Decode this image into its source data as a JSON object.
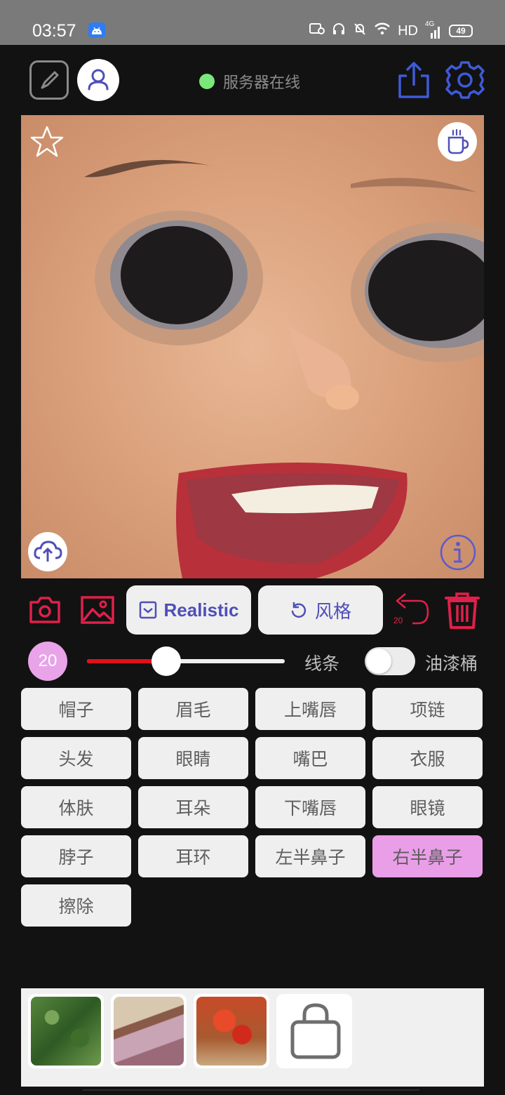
{
  "status_bar": {
    "time": "03:57",
    "network": "HD",
    "signal": "4G",
    "battery": "49"
  },
  "header": {
    "server_status": "服务器在线",
    "status_color": "#7be87b"
  },
  "tools": {
    "realistic_label": "Realistic",
    "style_label": "风格",
    "undo_count": "20",
    "accent_color": "#e0204a",
    "pill_text_color": "#4f4fb8"
  },
  "brush": {
    "size": "20",
    "slider_fraction": 0.4,
    "line_label": "线条",
    "bucket_label": "油漆桶",
    "bucket_enabled": false
  },
  "parts": [
    {
      "label": "帽子",
      "selected": false
    },
    {
      "label": "眉毛",
      "selected": false
    },
    {
      "label": "上嘴唇",
      "selected": false
    },
    {
      "label": "项链",
      "selected": false
    },
    {
      "label": "头发",
      "selected": false
    },
    {
      "label": "眼睛",
      "selected": false
    },
    {
      "label": "嘴巴",
      "selected": false
    },
    {
      "label": "衣服",
      "selected": false
    },
    {
      "label": "体肤",
      "selected": false
    },
    {
      "label": "耳朵",
      "selected": false
    },
    {
      "label": "下嘴唇",
      "selected": false
    },
    {
      "label": "眼镜",
      "selected": false
    },
    {
      "label": "脖子",
      "selected": false
    },
    {
      "label": "耳环",
      "selected": false
    },
    {
      "label": "左半鼻子",
      "selected": false
    },
    {
      "label": "右半鼻子",
      "selected": true
    },
    {
      "label": "擦除",
      "selected": false
    }
  ],
  "gallery": {
    "thumbnails": [
      "green-foliage",
      "lavender-bouquet",
      "red-flowers"
    ],
    "shop_icon": "shopping-bag-icon"
  }
}
